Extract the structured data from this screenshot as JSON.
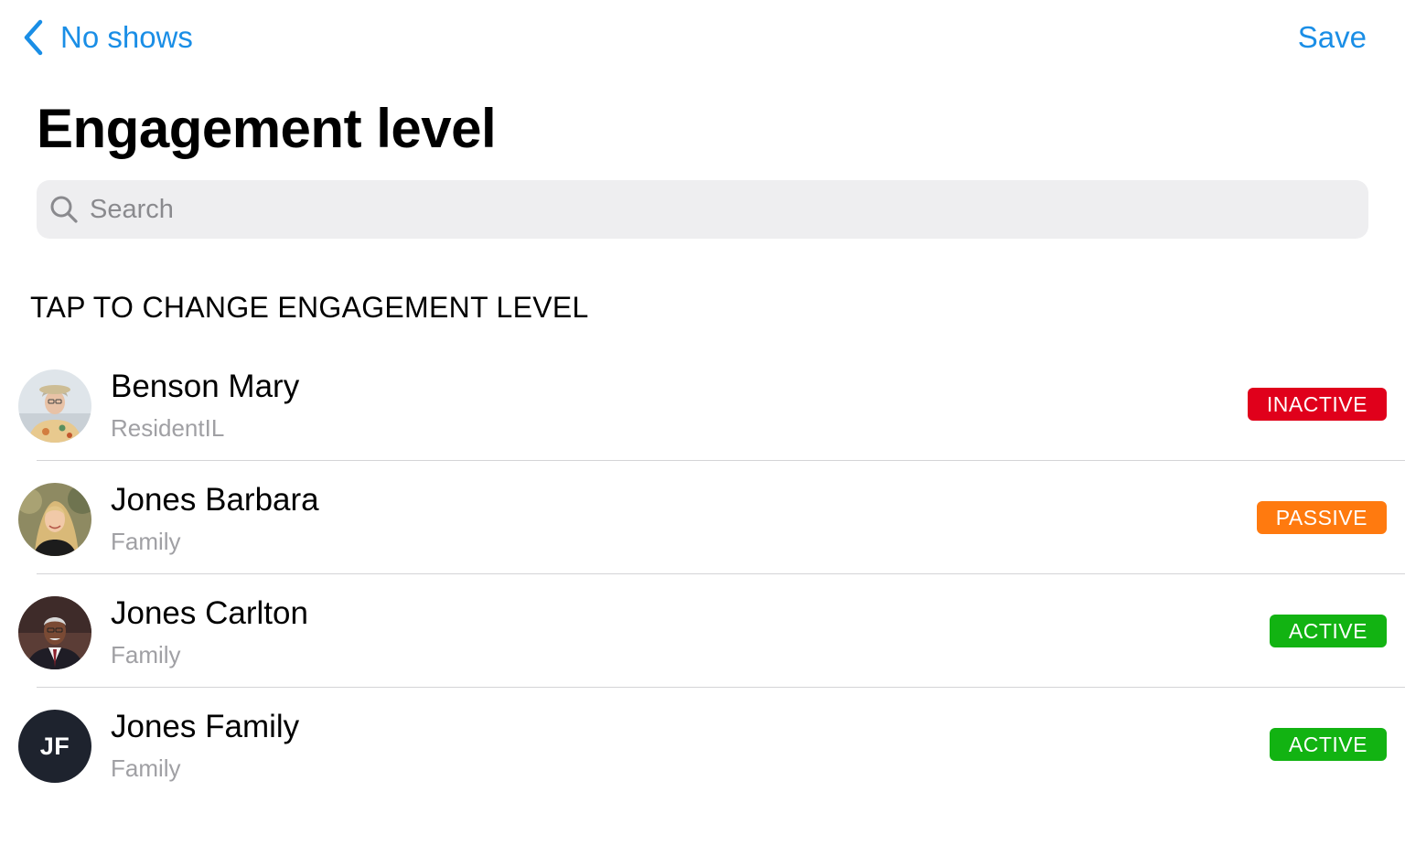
{
  "nav": {
    "back_label": "No shows",
    "save_label": "Save",
    "accent_color": "#1a8ee6"
  },
  "title": "Engagement level",
  "search": {
    "placeholder": "Search",
    "value": ""
  },
  "section_header": "TAP TO CHANGE ENGAGEMENT LEVEL",
  "people": [
    {
      "name": "Benson Mary",
      "role": "ResidentIL",
      "status": "INACTIVE",
      "status_color": "#e0001b",
      "avatar": "photo-elderly-woman"
    },
    {
      "name": "Jones Barbara",
      "role": "Family",
      "status": "PASSIVE",
      "status_color": "#ff7a0f",
      "avatar": "photo-blonde-woman"
    },
    {
      "name": "Jones Carlton",
      "role": "Family",
      "status": "ACTIVE",
      "status_color": "#12b312",
      "avatar": "photo-man-suit"
    },
    {
      "name": "Jones Family",
      "role": "Family",
      "status": "ACTIVE",
      "status_color": "#12b312",
      "avatar": "initials",
      "initials": "JF"
    }
  ]
}
